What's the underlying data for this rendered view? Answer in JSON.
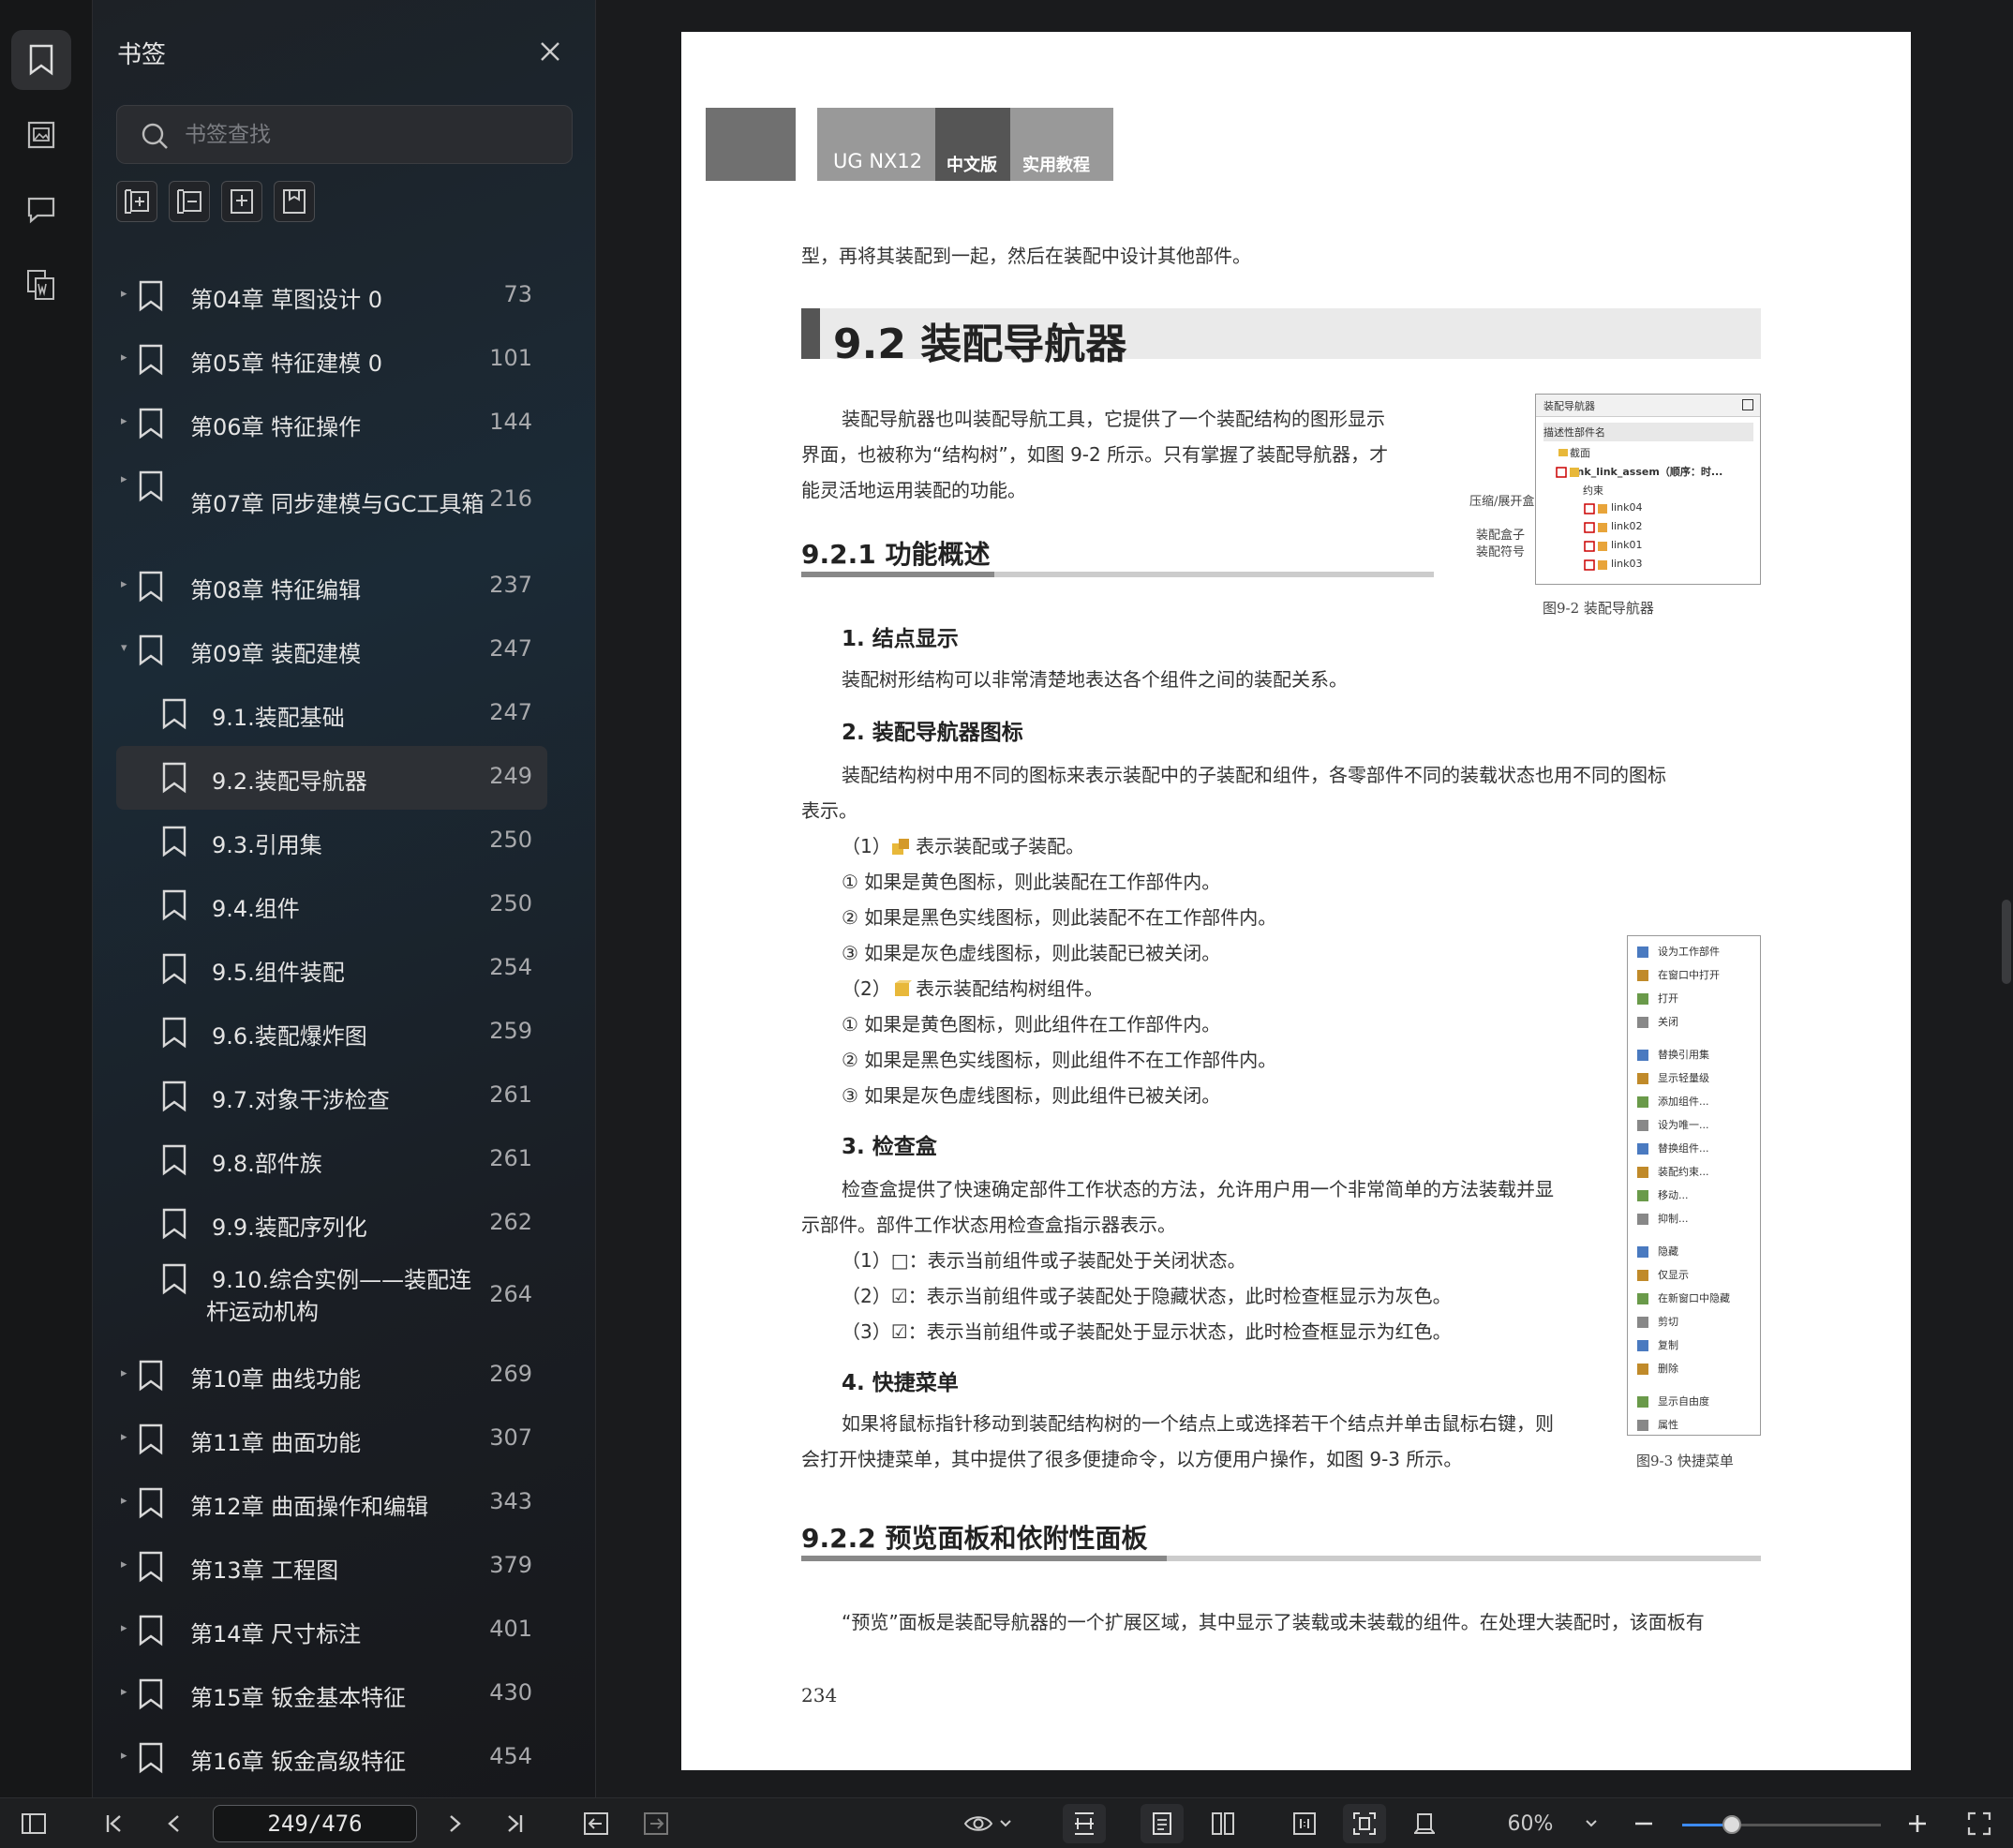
{
  "panel": {
    "title": "书签",
    "search_placeholder": "书签查找"
  },
  "bookmarks": [
    {
      "label": "第04章 草图设计 0",
      "page": "73",
      "level": 0,
      "arrow": "▸"
    },
    {
      "label": "第05章 特征建模 0",
      "page": "101",
      "level": 0,
      "arrow": "▸"
    },
    {
      "label": "第06章 特征操作",
      "page": "144",
      "level": 0,
      "arrow": "▸"
    },
    {
      "label": "第07章 同步建模与GC工具箱",
      "page": "216",
      "level": 0,
      "arrow": "▸"
    },
    {
      "label": "第08章 特征编辑",
      "page": "237",
      "level": 0,
      "arrow": "▸"
    },
    {
      "label": "第09章 装配建模",
      "page": "247",
      "level": 0,
      "arrow": "▾"
    },
    {
      "label": "9.1.装配基础",
      "page": "247",
      "level": 1
    },
    {
      "label": "9.2.装配导航器",
      "page": "249",
      "level": 1,
      "selected": true
    },
    {
      "label": "9.3.引用集",
      "page": "250",
      "level": 1
    },
    {
      "label": "9.4.组件",
      "page": "250",
      "level": 1
    },
    {
      "label": "9.5.组件装配",
      "page": "254",
      "level": 1
    },
    {
      "label": "9.6.装配爆炸图",
      "page": "259",
      "level": 1
    },
    {
      "label": "9.7.对象干涉检查",
      "page": "261",
      "level": 1
    },
    {
      "label": "9.8.部件族",
      "page": "261",
      "level": 1
    },
    {
      "label": "9.9.装配序列化",
      "page": "262",
      "level": 1
    },
    {
      "label": "9.10.综合实例——装配连",
      "label2": "杆运动机构",
      "page": "264",
      "level": 1
    },
    {
      "label": "第10章 曲线功能",
      "page": "269",
      "level": 0,
      "arrow": "▸"
    },
    {
      "label": "第11章 曲面功能",
      "page": "307",
      "level": 0,
      "arrow": "▸"
    },
    {
      "label": "第12章 曲面操作和编辑",
      "page": "343",
      "level": 0,
      "arrow": "▸"
    },
    {
      "label": "第13章 工程图",
      "page": "379",
      "level": 0,
      "arrow": "▸"
    },
    {
      "label": "第14章 尺寸标注",
      "page": "401",
      "level": 0,
      "arrow": "▸"
    },
    {
      "label": "第15章 钣金基本特征",
      "page": "430",
      "level": 0,
      "arrow": "▸"
    },
    {
      "label": "第16章 钣金高级特征",
      "page": "454",
      "level": 0,
      "arrow": "▸"
    }
  ],
  "toolbar": {
    "page_indicator": "249/476",
    "zoom": "60%",
    "zoom_fraction": 0.25
  },
  "doc": {
    "header_a": "UG NX12",
    "header_b": "中文版",
    "header_c": "实用教程",
    "line0": "型，再将其装配到一起，然后在装配中设计其他部件。",
    "h2": "9.2  装配导航器",
    "intro1": "装配导航器也叫装配导航工具，它提供了一个装配结构的图形显示",
    "intro2": "界面，也被称为“结构树”，如图 9-2 所示。只有掌握了装配导航器，才",
    "intro3": "能灵活地运用装配的功能。",
    "h3a": "9.2.1  功能概述",
    "s1": "1.  结点显示",
    "s1p": "装配树形结构可以非常清楚地表达各个组件之间的装配关系。",
    "s2": "2.  装配导航器图标",
    "s2p1": "装配结构树中用不同的图标来表示装配中的子装配和组件，各零部件不同的装载状态也用不同的图标",
    "s2p2": "表示。",
    "l1": "（1）    ：表示装配或子装配。",
    "l1a": "① 如果是黄色图标，则此装配在工作部件内。",
    "l1b": "② 如果是黑色实线图标，则此装配不在工作部件内。",
    "l1c": "③ 如果是灰色虚线图标，则此装配已被关闭。",
    "l2": "（2）    ：表示装配结构树组件。",
    "l2a": "① 如果是黄色图标，则此组件在工作部件内。",
    "l2b": "② 如果是黑色实线图标，则此组件不在工作部件内。",
    "l2c": "③ 如果是灰色虚线图标，则此组件已被关闭。",
    "s3": "3.  检查盒",
    "s3p1": "检查盒提供了快速确定部件工作状态的方法，允许用户用一个非常简单的方法装载并显",
    "s3p2": "示部件。部件工作状态用检查盒指示器表示。",
    "c1": "（1）□：表示当前组件或子装配处于关闭状态。",
    "c2": "（2）☑：表示当前组件或子装配处于隐藏状态，此时检查框显示为灰色。",
    "c3": "（3）☑：表示当前组件或子装配处于显示状态，此时检查框显示为红色。",
    "s4": "4.  快捷菜单",
    "s4p1": "如果将鼠标指针移动到装配结构树的一个结点上或选择若干个结点并单击鼠标右键，则",
    "s4p2": "会打开快捷菜单，其中提供了很多便捷命令，以方便用户操作，如图 9-3 所示。",
    "h3b": "9.2.2  预览面板和依附性面板",
    "last": "“预览”面板是装配导航器的一个扩展区域，其中显示了装载或未装载的组件。在处理大装配时，该面板有",
    "page_no": "234",
    "fig1_caption": "图9-2   装配导航器",
    "fig2_caption": "图9-3   快捷菜单",
    "fig1": {
      "title": "装配导航器",
      "col": "描述性部件名",
      "rows": [
        "截面",
        "link_link_assem（顺序：时...",
        "约束",
        "link04",
        "link02",
        "link01",
        "link03"
      ],
      "lab1": "压缩/展开盒",
      "lab2": "装配盒子",
      "lab3": "装配符号"
    },
    "fig2": [
      "设为工作部件",
      "在窗口中打开",
      "打开",
      "关闭",
      "替换引用集",
      "显示轻量级",
      "添加组件...",
      "设为唯一...",
      "替换组件...",
      "装配约束...",
      "移动...",
      "抑制...",
      "隐藏",
      "仅显示",
      "在新窗口中隐藏",
      "剪切",
      "复制",
      "删除",
      "显示自由度",
      "属性"
    ]
  }
}
